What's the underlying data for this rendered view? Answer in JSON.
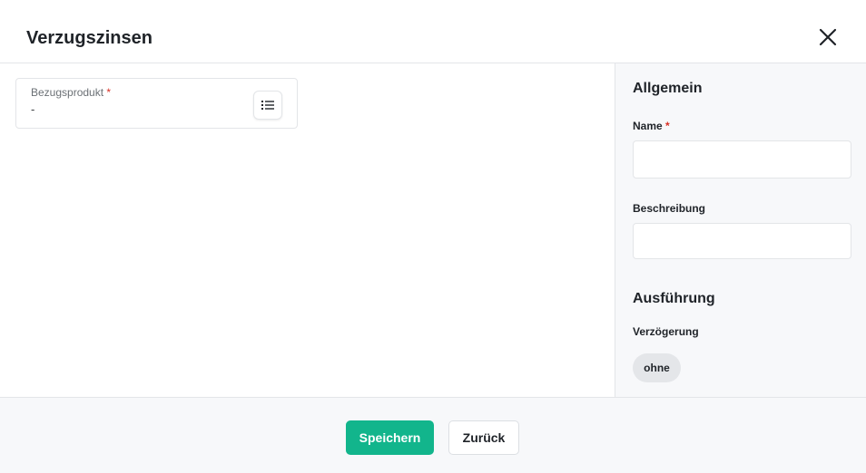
{
  "dialog": {
    "title": "Verzugszinsen"
  },
  "main": {
    "product": {
      "label": "Bezugsprodukt",
      "required_mark": "*",
      "value": "-"
    }
  },
  "side": {
    "general": {
      "title": "Allgemein",
      "name_label": "Name",
      "name_required_mark": "*",
      "name_value": "",
      "description_label": "Beschreibung",
      "description_value": ""
    },
    "execution": {
      "title": "Ausführung",
      "delay_label": "Verzögerung",
      "delay_chip": "ohne"
    }
  },
  "footer": {
    "save_label": "Speichern",
    "back_label": "Zurück"
  },
  "colors": {
    "primary": "#12b58c",
    "required": "#d93025",
    "panel_bg": "#f7f8fa",
    "border": "#e3e5e8"
  },
  "icons": {
    "close": "close-icon",
    "list": "list-icon"
  }
}
